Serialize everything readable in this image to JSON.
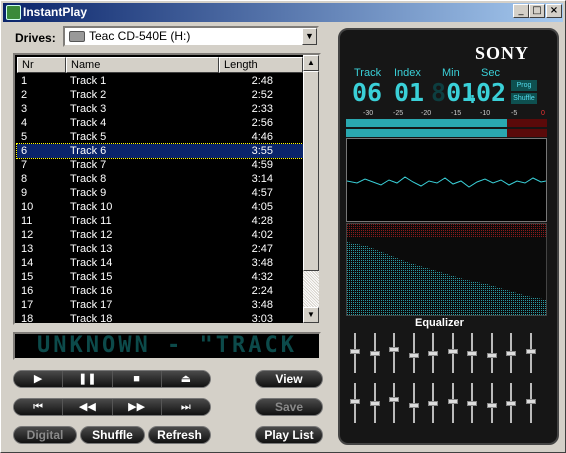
{
  "window": {
    "title": "InstantPlay",
    "min": "_",
    "max": "□",
    "close": "×"
  },
  "drives": {
    "label": "Drives:",
    "selected": "Teac CD-540E (H:)"
  },
  "tracklist": {
    "headers": {
      "nr": "Nr",
      "name": "Name",
      "length": "Length"
    },
    "selected_index": 5,
    "rows": [
      {
        "nr": "1",
        "name": "Track 1",
        "length": "2:48"
      },
      {
        "nr": "2",
        "name": "Track 2",
        "length": "2:52"
      },
      {
        "nr": "3",
        "name": "Track 3",
        "length": "2:33"
      },
      {
        "nr": "4",
        "name": "Track 4",
        "length": "2:56"
      },
      {
        "nr": "5",
        "name": "Track 5",
        "length": "4:46"
      },
      {
        "nr": "6",
        "name": "Track 6",
        "length": "3:55"
      },
      {
        "nr": "7",
        "name": "Track 7",
        "length": "4:59"
      },
      {
        "nr": "8",
        "name": "Track 8",
        "length": "3:14"
      },
      {
        "nr": "9",
        "name": "Track 9",
        "length": "4:57"
      },
      {
        "nr": "10",
        "name": "Track 10",
        "length": "4:05"
      },
      {
        "nr": "11",
        "name": "Track 11",
        "length": "4:28"
      },
      {
        "nr": "12",
        "name": "Track 12",
        "length": "4:02"
      },
      {
        "nr": "13",
        "name": "Track 13",
        "length": "2:47"
      },
      {
        "nr": "14",
        "name": "Track 14",
        "length": "3:48"
      },
      {
        "nr": "15",
        "name": "Track 15",
        "length": "4:32"
      },
      {
        "nr": "16",
        "name": "Track 16",
        "length": "2:24"
      },
      {
        "nr": "17",
        "name": "Track 17",
        "length": "3:48"
      },
      {
        "nr": "18",
        "name": "Track 18",
        "length": "3:03"
      }
    ]
  },
  "marquee": {
    "text": "UNKNOWN - \"TRACK"
  },
  "transport": {
    "play": "▶",
    "pause": "❚❚",
    "stop": "■",
    "eject": "⏏",
    "prev": "⏮",
    "rew": "◀◀",
    "ff": "▶▶",
    "next": "⏭"
  },
  "buttons": {
    "view": "View",
    "save": "Save",
    "digital": "Digital",
    "shuffle": "Shuffle",
    "refresh": "Refresh",
    "playlist": "Play List"
  },
  "display": {
    "brand": "SONY",
    "labels": {
      "track": "Track",
      "index": "Index",
      "min": "Min",
      "sec": "Sec"
    },
    "track": "06",
    "index": "01",
    "min": "01",
    "sec": "02",
    "prog": "Prog",
    "shuffle": "Shuffle",
    "scale": [
      "-30",
      "-25",
      "-20",
      "-15",
      "-10",
      "-5",
      "0"
    ],
    "equalizer_label": "Equalizer",
    "eq_levels": [
      0.55,
      0.5,
      0.6,
      0.45,
      0.5,
      0.55,
      0.5,
      0.45,
      0.5,
      0.55
    ]
  },
  "colors": {
    "lcd": "#3ad0d8",
    "lcd_dim": "#0d3e40",
    "selection": "#0a246a",
    "titlebar": "#0a246a"
  }
}
